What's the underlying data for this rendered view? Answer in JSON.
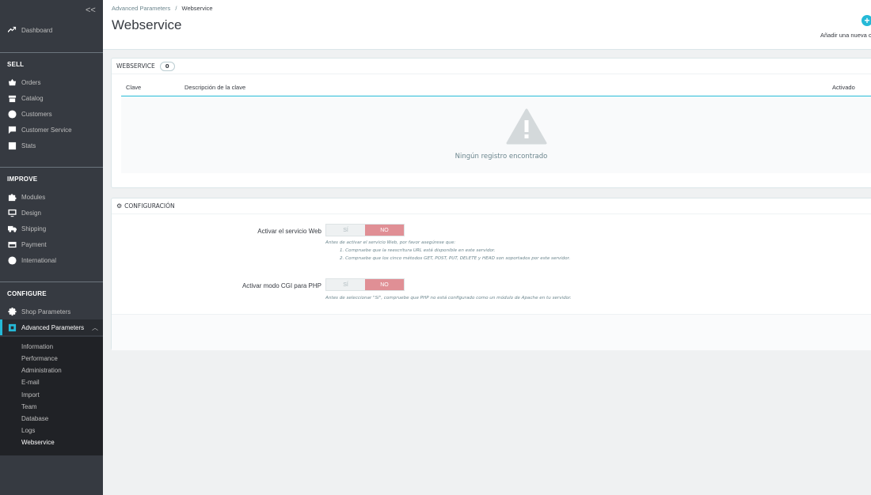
{
  "sidebar": {
    "collapse_label": "<<",
    "dashboard": "Dashboard",
    "sections": {
      "sell": "SELL",
      "improve": "IMPROVE",
      "configure": "CONFIGURE"
    },
    "sell_items": [
      "Orders",
      "Catalog",
      "Customers",
      "Customer Service",
      "Stats"
    ],
    "improve_items": [
      "Modules",
      "Design",
      "Shipping",
      "Payment",
      "International"
    ],
    "configure_items": [
      "Shop Parameters",
      "Advanced Parameters"
    ],
    "sub_items": [
      "Information",
      "Performance",
      "Administration",
      "E-mail",
      "Import",
      "Team",
      "Database",
      "Logs",
      "Webservice"
    ],
    "active_item": "Advanced Parameters",
    "current_sub": "Webservice"
  },
  "header": {
    "breadcrumb_parent": "Advanced Parameters",
    "breadcrumb_sep": "/",
    "breadcrumb_current": "Webservice",
    "title": "Webservice",
    "add_label": "Añadir una nueva c"
  },
  "webservice_panel": {
    "title": "WEBSERVICE",
    "count": "0",
    "columns": [
      "Clave",
      "Descripción de la clave",
      "Activado"
    ],
    "empty_text": "Ningún registro encontrado"
  },
  "config_panel": {
    "title": "CONFIGURACIÓN",
    "field1": {
      "label": "Activar el servicio Web",
      "yes": "SÍ",
      "no": "NO",
      "help_intro": "Antes de activar el servicio Web, por favor asegúrese que:",
      "help_1": "1. Compruebe que la reescritura URL está disponible en este servidor.",
      "help_2": "2. Compruebe que los cinco métodos GET, POST, PUT, DELETE y HEAD son soportados por este servidor."
    },
    "field2": {
      "label": "Activar modo CGI para PHP",
      "yes": "SÍ",
      "no": "NO",
      "help": "Antes de seleccionar \"Sí\", compruebe que PHP no está configurado como un módulo de Apache en tu servidor."
    }
  },
  "colors": {
    "sidebar_bg": "#363a41",
    "accent": "#25b9d7",
    "switch_no": "#e08f95"
  }
}
